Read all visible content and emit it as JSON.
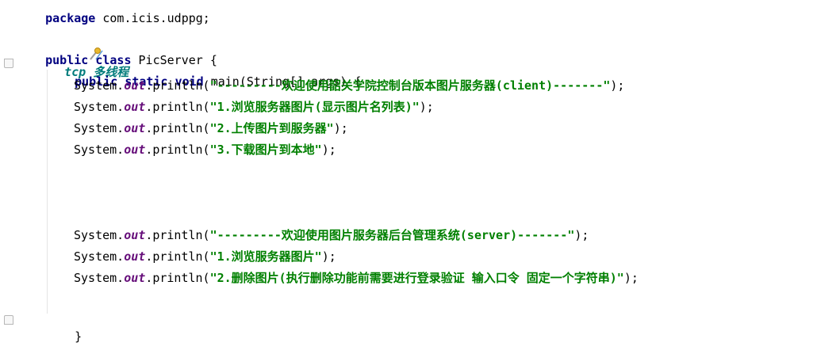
{
  "editor": {
    "package_line": {
      "keyword": "package",
      "name": "com.icis.udppg;"
    },
    "comment": {
      "icon": "tool-icon",
      "prefix": "//",
      "text": "tcp 多线程"
    },
    "class_decl": {
      "kw1": "public",
      "kw2": "class",
      "name": "PicServer {"
    },
    "method_decl": {
      "kw1": "public",
      "kw2": "static",
      "kw3": "void",
      "rest": "main(String[] args) {"
    },
    "print_prefix": "System.",
    "print_field": "out",
    "print_method": ".println(",
    "print_suffix": ");",
    "client_lines": [
      "\"---------欢迎使用韶关学院控制台版本图片服务器(client)-------\"",
      "\"1.浏览服务器图片(显示图片名列表)\"",
      "\"2.上传图片到服务器\"",
      "\"3.下载图片到本地\""
    ],
    "server_lines": [
      "\"---------欢迎使用图片服务器后台管理系统(server)-------\"",
      "\"1.浏览服务器图片\"",
      "\"2.删除图片(执行删除功能前需要进行登录验证 输入口令 固定一个字符串)\""
    ],
    "method_close": "}",
    "class_close": "}"
  }
}
